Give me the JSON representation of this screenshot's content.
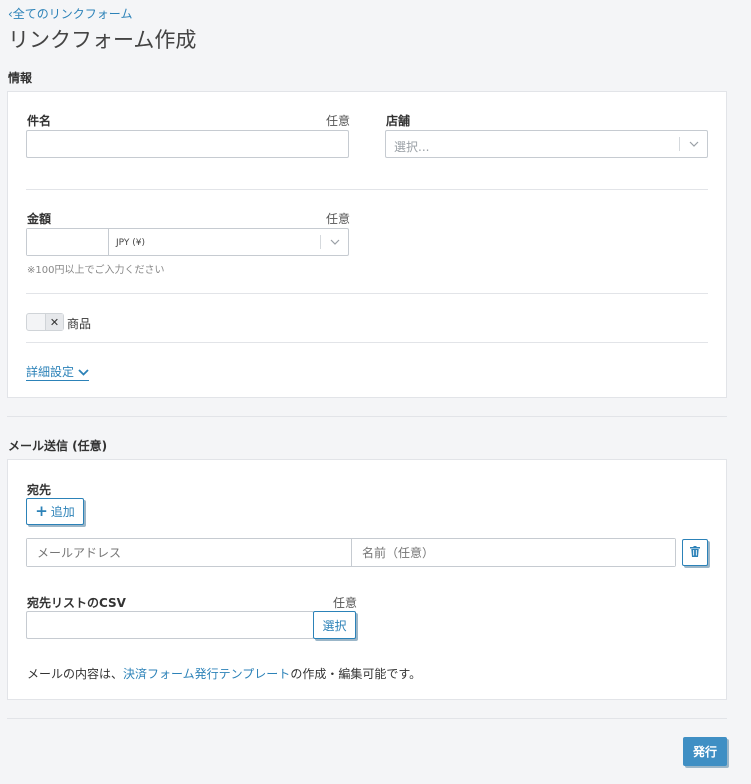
{
  "header": {
    "back_link": "‹全てのリンクフォーム",
    "title": "リンクフォーム作成"
  },
  "info": {
    "section_title": "情報",
    "subject_label": "件名",
    "subject_optional": "任意",
    "subject_value": "",
    "store_label": "店舗",
    "store_placeholder": "選択...",
    "amount_label": "金額",
    "amount_optional": "任意",
    "amount_value": "",
    "currency_value": "JPY (¥)",
    "amount_hint": "※100円以上でご入力ください",
    "product_label": "商品",
    "product_toggle_on": false,
    "advanced_link": "詳細設定"
  },
  "mail": {
    "section_title": "メール送信 (任意)",
    "recipient_label": "宛先",
    "add_button": "追加",
    "email_placeholder": "メールアドレス",
    "name_placeholder": "名前（任意）",
    "csv_label": "宛先リストのCSV",
    "csv_optional": "任意",
    "csv_select_button": "選択",
    "note_prefix": "メールの内容は、",
    "note_link": "決済フォーム発行テンプレート",
    "note_suffix": "の作成・編集可能です。"
  },
  "footer": {
    "publish_button": "発行"
  },
  "colors": {
    "accent": "#2c82b8",
    "primary_button": "#3f8fc4",
    "background": "#f4f5f7"
  }
}
